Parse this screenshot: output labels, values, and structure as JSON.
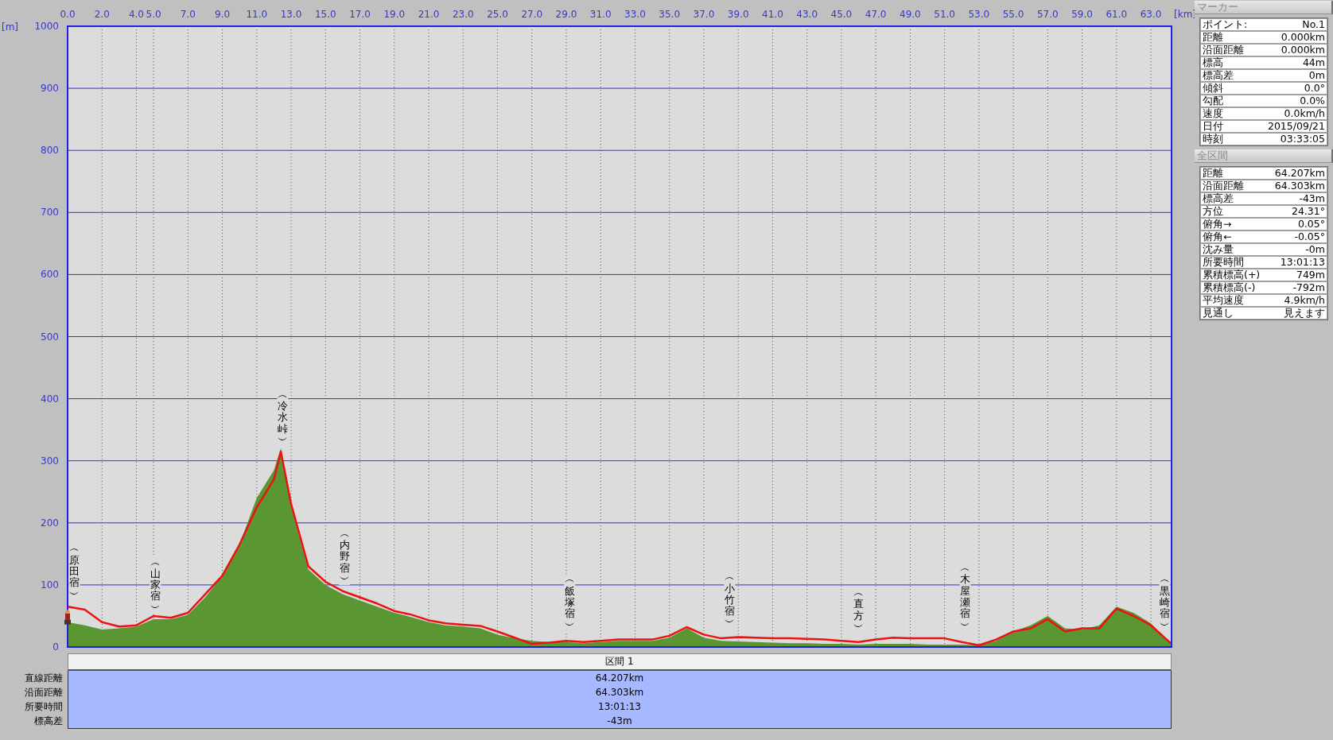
{
  "chart": {
    "chart_data": {
      "type": "area",
      "xlabel": "[km]",
      "ylabel": "[m]",
      "xlim": [
        0,
        64.2
      ],
      "ylim": [
        0,
        1000
      ],
      "xticks": [
        {
          "value": 0,
          "label": "0.0"
        },
        {
          "value": 2,
          "label": "2.0"
        },
        {
          "value": 4,
          "label": "4.0"
        },
        {
          "value": 5,
          "label": "5.0"
        },
        {
          "value": 7,
          "label": "7.0"
        },
        {
          "value": 9,
          "label": "9.0"
        },
        {
          "value": 11,
          "label": "11.0"
        },
        {
          "value": 13,
          "label": "13.0"
        },
        {
          "value": 15,
          "label": "15.0"
        },
        {
          "value": 17,
          "label": "17.0"
        },
        {
          "value": 19,
          "label": "19.0"
        },
        {
          "value": 21,
          "label": "21.0"
        },
        {
          "value": 23,
          "label": "23.0"
        },
        {
          "value": 25,
          "label": "25.0"
        },
        {
          "value": 27,
          "label": "27.0"
        },
        {
          "value": 29,
          "label": "29.0"
        },
        {
          "value": 31,
          "label": "31.0"
        },
        {
          "value": 33,
          "label": "33.0"
        },
        {
          "value": 35,
          "label": "35.0"
        },
        {
          "value": 37,
          "label": "37.0"
        },
        {
          "value": 39,
          "label": "39.0"
        },
        {
          "value": 41,
          "label": "41.0"
        },
        {
          "value": 43,
          "label": "43.0"
        },
        {
          "value": 45,
          "label": "45.0"
        },
        {
          "value": 47,
          "label": "47.0"
        },
        {
          "value": 49,
          "label": "49.0"
        },
        {
          "value": 51,
          "label": "51.0"
        },
        {
          "value": 53,
          "label": "53.0"
        },
        {
          "value": 55,
          "label": "55.0"
        },
        {
          "value": 57,
          "label": "57.0"
        },
        {
          "value": 59,
          "label": "59.0"
        },
        {
          "value": 61,
          "label": "61.0"
        },
        {
          "value": 63,
          "label": "63.0"
        }
      ],
      "yticks": [
        0,
        100,
        200,
        300,
        400,
        500,
        600,
        700,
        800,
        900,
        1000
      ],
      "x": [
        0,
        1,
        2,
        3,
        4,
        5,
        6,
        7,
        8,
        9,
        10,
        11,
        12,
        12.4,
        13,
        14,
        15,
        16,
        17,
        18,
        19,
        20,
        21,
        22,
        23,
        24,
        25,
        26,
        27,
        28,
        29,
        30,
        31,
        32,
        33,
        34,
        35,
        36,
        37,
        38,
        39,
        40,
        41,
        42,
        43,
        44,
        45,
        46,
        47,
        48,
        49,
        50,
        51,
        52,
        53,
        54,
        55,
        56,
        57,
        58,
        59,
        60,
        61,
        62,
        63,
        64.2
      ],
      "series": [
        {
          "type": "area",
          "color": "#5a9632",
          "values": [
            40,
            35,
            28,
            30,
            33,
            45,
            45,
            52,
            80,
            115,
            165,
            240,
            285,
            320,
            225,
            125,
            100,
            85,
            75,
            65,
            55,
            48,
            40,
            35,
            33,
            30,
            20,
            14,
            10,
            8,
            8,
            6,
            8,
            10,
            10,
            10,
            15,
            30,
            15,
            10,
            9,
            8,
            7,
            6,
            6,
            5,
            5,
            4,
            5,
            5,
            5,
            4,
            4,
            4,
            3,
            10,
            25,
            35,
            50,
            30,
            28,
            35,
            65,
            55,
            38,
            3
          ]
        },
        {
          "type": "line",
          "color": "#ee1111",
          "values": [
            65,
            60,
            40,
            33,
            35,
            50,
            47,
            55,
            85,
            115,
            165,
            225,
            270,
            315,
            230,
            130,
            105,
            90,
            80,
            70,
            58,
            52,
            43,
            38,
            36,
            34,
            25,
            15,
            5,
            7,
            10,
            8,
            10,
            12,
            12,
            12,
            18,
            32,
            20,
            14,
            16,
            15,
            14,
            14,
            13,
            12,
            10,
            8,
            12,
            15,
            14,
            14,
            14,
            8,
            3,
            12,
            25,
            30,
            45,
            25,
            30,
            30,
            62,
            50,
            35,
            5
          ]
        }
      ],
      "annotations": [
        "︵原田宿︶",
        "︵山家宿︶",
        "︵冷水峠︶",
        "︵内野宿︶",
        "︵飯塚宿︶",
        "︵小竹宿︶",
        "︵直方︶",
        "︵木屋瀬宿︶",
        "︵黒崎宿︶"
      ],
      "grid": true
    }
  },
  "summary_table": {
    "header": "区間 1",
    "rows": [
      {
        "label": "直線距離",
        "value": "64.207km"
      },
      {
        "label": "沿面距離",
        "value": "64.303km"
      },
      {
        "label": "所要時間",
        "value": "13:01:13"
      },
      {
        "label": "標高差",
        "value": "-43m"
      }
    ]
  },
  "side_panel": {
    "sections": [
      {
        "title": "マーカー",
        "rows": [
          {
            "label": "ポイント:",
            "value": "No.1"
          },
          {
            "label": "距離",
            "value": "0.000km"
          },
          {
            "label": "沿面距離",
            "value": "0.000km"
          },
          {
            "label": "標高",
            "value": "44m"
          },
          {
            "label": "標高差",
            "value": "0m"
          },
          {
            "label": "傾斜",
            "value": "0.0°"
          },
          {
            "label": "勾配",
            "value": "0.0%"
          },
          {
            "label": "速度",
            "value": "0.0km/h"
          },
          {
            "label": "日付",
            "value": "2015/09/21"
          },
          {
            "label": "時刻",
            "value": "03:33:05"
          }
        ]
      },
      {
        "title": "全区間",
        "rows": [
          {
            "label": "距離",
            "value": "64.207km"
          },
          {
            "label": "沿面距離",
            "value": "64.303km"
          },
          {
            "label": "標高差",
            "value": "-43m"
          },
          {
            "label": "方位",
            "value": "24.31°"
          },
          {
            "label": "俯角→",
            "value": "0.05°"
          },
          {
            "label": "俯角←",
            "value": "-0.05°"
          },
          {
            "label": "沈み量",
            "value": "-0m"
          },
          {
            "label": "所要時間",
            "value": "13:01:13"
          },
          {
            "label": "累積標高(+)",
            "value": "749m"
          },
          {
            "label": "累積標高(-)",
            "value": "-792m"
          },
          {
            "label": "平均速度",
            "value": "4.9km/h"
          },
          {
            "label": "見通し",
            "value": "見えます"
          }
        ]
      }
    ]
  }
}
